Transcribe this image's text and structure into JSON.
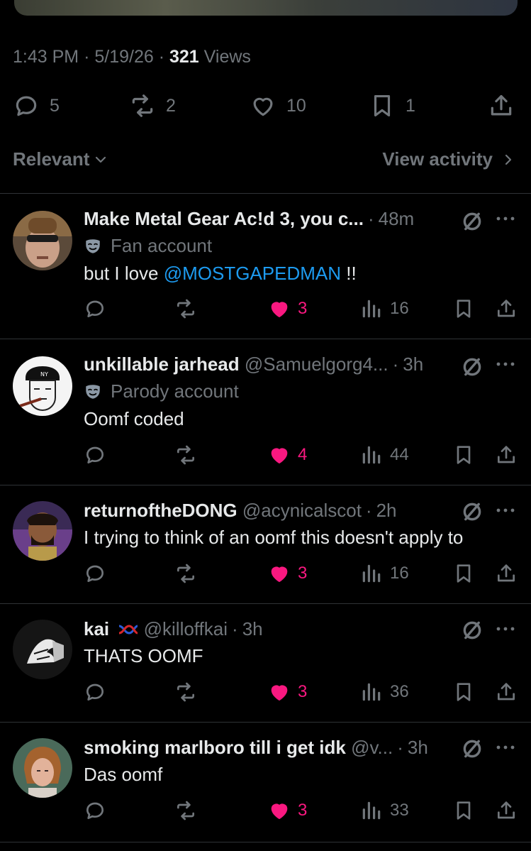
{
  "post_meta": {
    "time": "1:43 PM",
    "date": "5/19/26",
    "views_count": "321",
    "views_label": "Views",
    "separator": "·"
  },
  "post_actions": {
    "replies": "5",
    "reposts": "2",
    "likes": "10",
    "bookmarks": "1"
  },
  "sort": {
    "label": "Relevant",
    "activity_label": "View activity"
  },
  "colors": {
    "background": "#000000",
    "text": "#e7e9ea",
    "muted": "#71767b",
    "link": "#1d9bf0",
    "like": "#f91880",
    "divider": "#2f3336"
  },
  "replies": [
    {
      "name": "Make Metal Gear Ac!d 3, you c...",
      "handle": "",
      "time": "48m",
      "badge": "Fan account",
      "badge_icon": "mask-icon",
      "text": "but I love ",
      "mention": "@MOSTGAPEDMAN",
      "text_after": " !!",
      "replies": "",
      "reposts": "",
      "likes": "3",
      "liked": true,
      "views": "16"
    },
    {
      "name": "unkillable jarhead",
      "handle": "@Samuelgorg4...",
      "time": "3h",
      "badge": "Parody account",
      "badge_icon": "mask-icon",
      "text": "Oomf coded",
      "likes": "4",
      "liked": true,
      "views": "44"
    },
    {
      "name": "returnoftheDONG",
      "handle": "@acynicalscot",
      "time": "2h",
      "text": "I trying to think of an oomf this doesn't apply to",
      "likes": "3",
      "liked": true,
      "views": "16"
    },
    {
      "name": "kai",
      "name_emoji": "knot-emoji",
      "handle": "@killoffkai",
      "time": "3h",
      "text": "THATS OOMF",
      "likes": "3",
      "liked": true,
      "views": "36"
    },
    {
      "name": "smoking marlboro till i get idk",
      "handle": "@v...",
      "time": "3h",
      "text": "Das oomf",
      "likes": "3",
      "liked": true,
      "views": "33"
    }
  ]
}
